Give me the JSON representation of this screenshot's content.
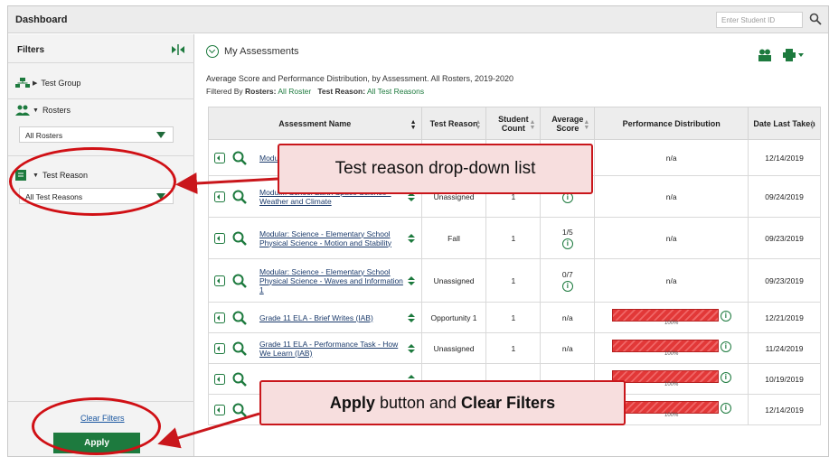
{
  "header": {
    "title": "Dashboard",
    "student_placeholder": "Enter Student ID"
  },
  "sidebar": {
    "heading": "Filters",
    "test_group_label": "Test Group",
    "rosters_label": "Rosters",
    "rosters_value": "All Rosters",
    "test_reason_label": "Test Reason",
    "test_reason_value": "All Test Reasons",
    "clear_filters": "Clear Filters",
    "apply": "Apply"
  },
  "main": {
    "title": "My Assessments",
    "subtitle": "Average Score and Performance Distribution, by Assessment. All Rosters, 2019-2020",
    "filtered_prefix": "Filtered By",
    "rosters_key": "Rosters:",
    "rosters_val": "All Roster",
    "reason_key": "Test Reason:",
    "reason_val": "All Test Reasons"
  },
  "table": {
    "headers": [
      "Assessment Name",
      "Test Reason",
      "Student Count",
      "Average Score",
      "Performance Distribution",
      "Date Last Taken"
    ],
    "rows": [
      {
        "name": "Modular... School... ...",
        "reason": "",
        "count": "",
        "score": "",
        "perf": "n/a",
        "date": "12/14/2019"
      },
      {
        "name": "Modul... School Earth Space Science - Weather and Climate",
        "reason": "Unassigned",
        "count": "1",
        "score": "",
        "perf": "n/a",
        "date": "09/24/2019"
      },
      {
        "name": "Modular: Science - Elementary School Physical Science - Motion and Stability",
        "reason": "Fall",
        "count": "1",
        "score": "1/5",
        "perf": "n/a",
        "date": "09/23/2019"
      },
      {
        "name": "Modular: Science - Elementary School Physical Science - Waves and Information 1",
        "reason": "Unassigned",
        "count": "1",
        "score": "0/7",
        "perf": "n/a",
        "date": "09/23/2019"
      },
      {
        "name": "Grade 11 ELA - Brief Writes (IAB)",
        "reason": "Opportunity 1",
        "count": "1",
        "score": "n/a",
        "perf_pct": "100%",
        "date": "12/21/2019"
      },
      {
        "name": "Grade 11 ELA - Performance Task - How We Learn (IAB)",
        "reason": "Unassigned",
        "count": "1",
        "score": "n/a",
        "perf_pct": "100%",
        "date": "11/24/2019"
      },
      {
        "name": "",
        "reason": "",
        "count": "",
        "score": "",
        "perf_pct": "100%",
        "date": "10/19/2019"
      },
      {
        "name": "",
        "reason": "",
        "count": "",
        "score": "",
        "perf_pct": "100%",
        "date": "12/14/2019"
      }
    ]
  },
  "callouts": {
    "test_reason": "Test reason drop-down list",
    "apply_bold": "Apply",
    "apply_mid": " button and ",
    "clear_bold": "Clear Filters"
  },
  "colors": {
    "accent": "#1d7a3e",
    "callout_border": "#c9161b",
    "bar": "#e23838"
  }
}
